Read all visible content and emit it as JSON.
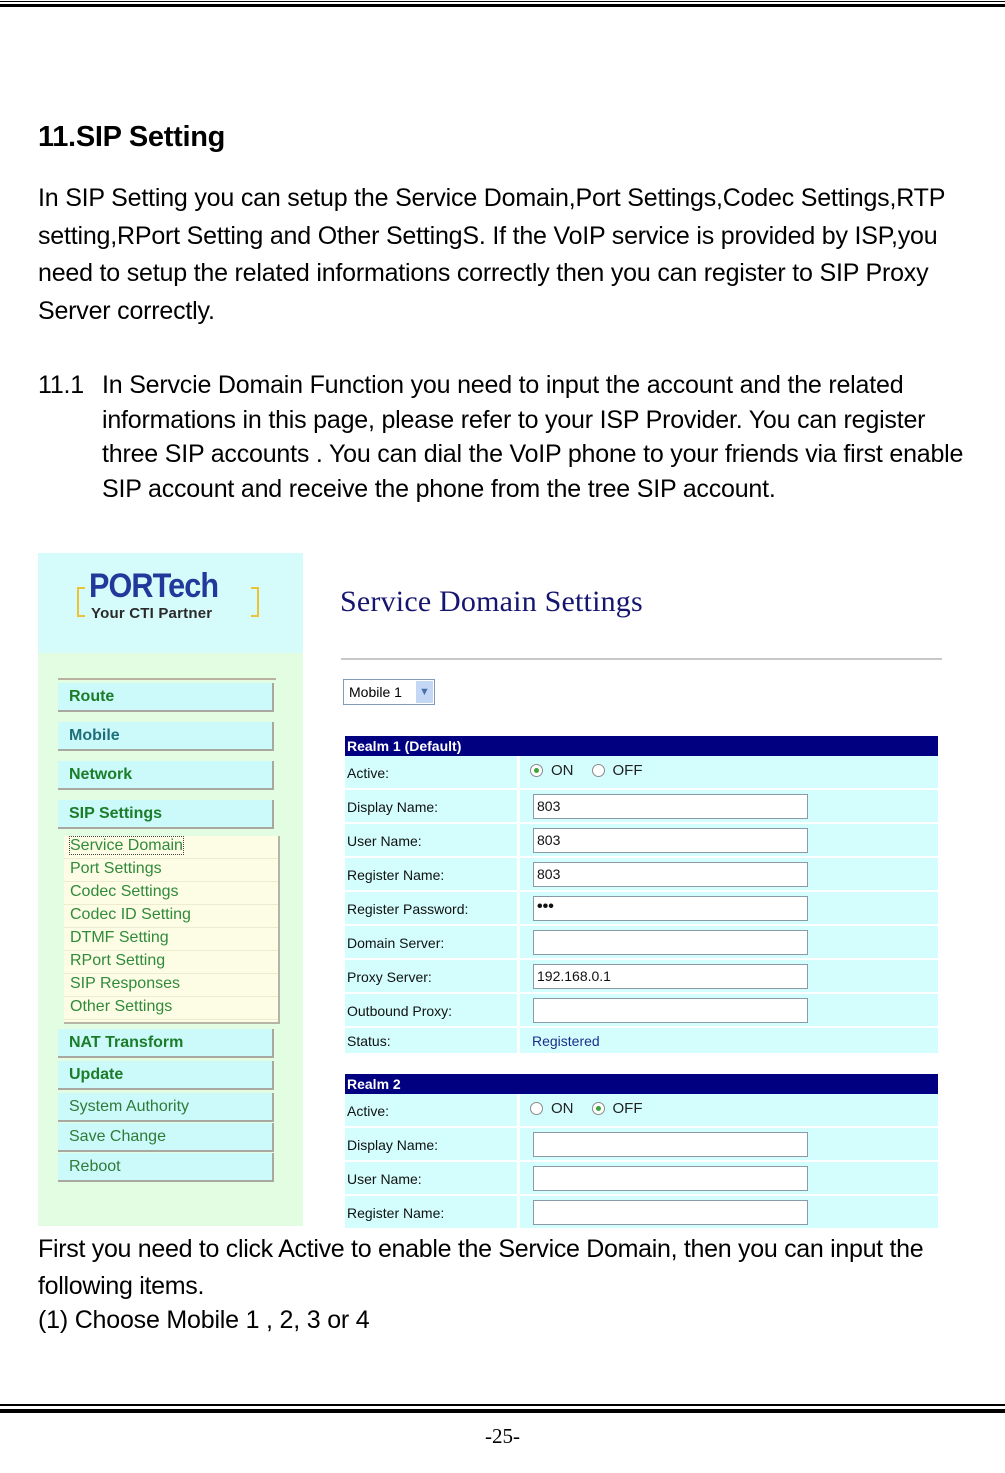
{
  "document": {
    "section_title": "11.SIP Setting",
    "intro": "In SIP Setting you can setup the Service Domain,Port Settings,Codec Settings,RTP setting,RPort Setting and Other SettingS. If the VoIP service is provided by ISP,you need to setup the related informations correctly then you can register to SIP Proxy Server correctly.",
    "subsection": {
      "number": "11.1",
      "text": "In Servcie Domain Function you need to input the account and the related informations in this page, please refer to your ISP Provider. You can register three SIP accounts . You can dial the VoIP phone to your friends via first enable SIP account and receive the phone from the tree SIP account."
    },
    "caption": "First you need to click Active to enable the Service Domain, then you can input the following items.",
    "step_1": "(1) Choose Mobile 1 , 2, 3 or 4",
    "page_number": "-25-"
  },
  "screenshot": {
    "logo": {
      "brand": "PORTech",
      "tagline": "Your CTI Partner"
    },
    "nav": {
      "top_items": [
        "Route",
        "Mobile",
        "Network",
        "SIP Settings"
      ],
      "sip_submenu": [
        "Service Domain",
        "Port Settings",
        "Codec Settings",
        "Codec ID Setting",
        "DTMF Setting",
        "RPort Setting",
        "SIP Responses",
        "Other Settings"
      ],
      "selected_submenu": "Service Domain",
      "bottom_items": [
        "NAT Transform",
        "Update",
        "System Authority",
        "Save Change",
        "Reboot"
      ]
    },
    "page_title": "Service Domain Settings",
    "mobile_select": {
      "value": "Mobile 1"
    },
    "realm1": {
      "header": "Realm 1 (Default)",
      "labels": {
        "active": "Active:",
        "display_name": "Display Name:",
        "user_name": "User Name:",
        "register_name": "Register Name:",
        "register_password": "Register Password:",
        "domain_server": "Domain Server:",
        "proxy_server": "Proxy Server:",
        "outbound_proxy": "Outbound Proxy:",
        "status": "Status:"
      },
      "active": {
        "on_label": "ON",
        "off_label": "OFF",
        "selected": "ON"
      },
      "values": {
        "display_name": "803",
        "user_name": "803",
        "register_name": "803",
        "register_password": "•••",
        "domain_server": "",
        "proxy_server": "192.168.0.1",
        "outbound_proxy": "",
        "status": "Registered"
      }
    },
    "realm2": {
      "header": "Realm 2",
      "labels": {
        "active": "Active:",
        "display_name": "Display Name:",
        "user_name": "User Name:",
        "register_name": "Register Name:"
      },
      "active": {
        "on_label": "ON",
        "off_label": "OFF",
        "selected": "OFF"
      },
      "values": {
        "display_name": "",
        "user_name": "",
        "register_name": ""
      }
    },
    "colors": {
      "realm_header": "#000080",
      "row_background": "#d4fdfd",
      "sidebar_background": "#e2fde2",
      "nav_text": "#1b7d2a",
      "title_text": "#151570"
    }
  }
}
